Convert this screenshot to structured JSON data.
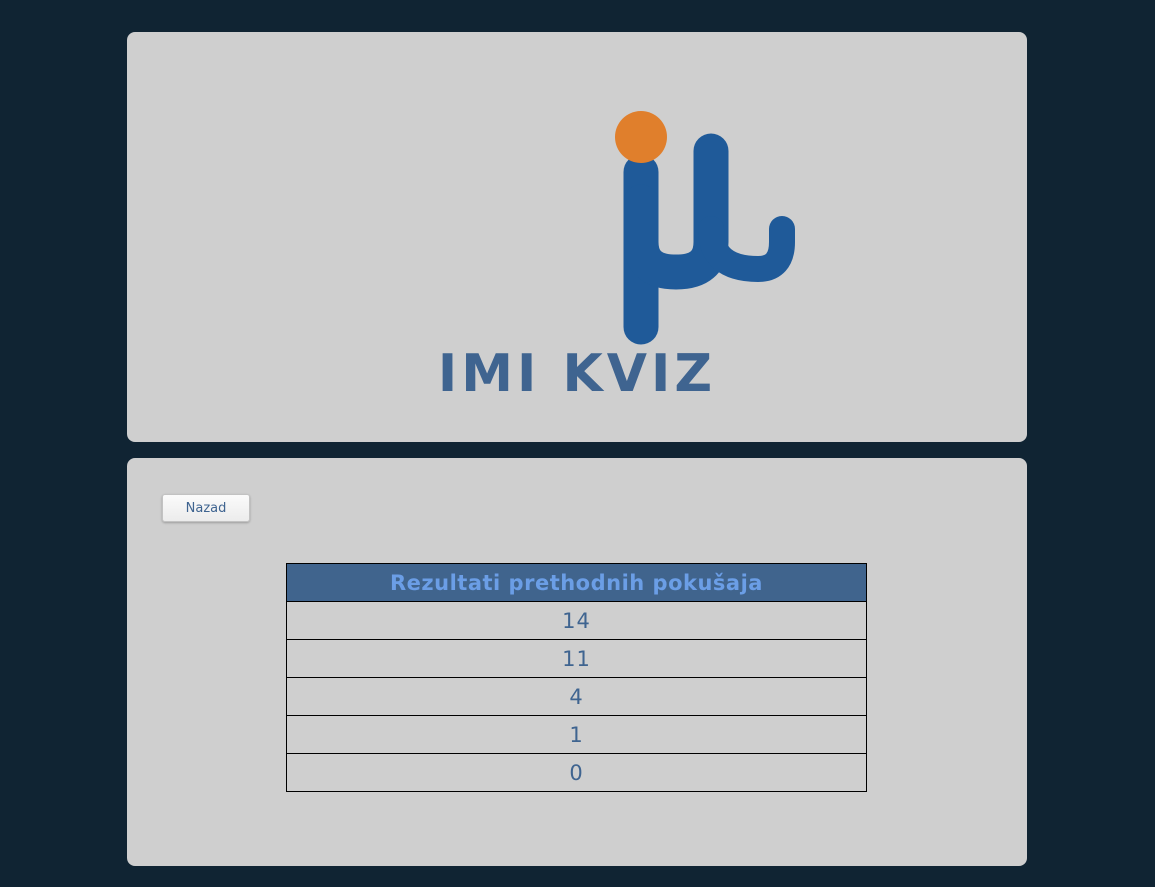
{
  "app": {
    "title": "IMI KVIZ",
    "logo": "mu-icon",
    "colors": {
      "background": "#102433",
      "panel": "#cfcfcf",
      "brand_blue": "#1f5a99",
      "brand_orange": "#e07f2c",
      "title": "#3f6490",
      "table_header_bg": "#40648d",
      "table_header_text": "#6b9ee6"
    }
  },
  "toolbar": {
    "back_label": "Nazad"
  },
  "results": {
    "header": "Rezultati prethodnih pokušaja",
    "rows": [
      "14",
      "11",
      "4",
      "1",
      "0"
    ]
  }
}
